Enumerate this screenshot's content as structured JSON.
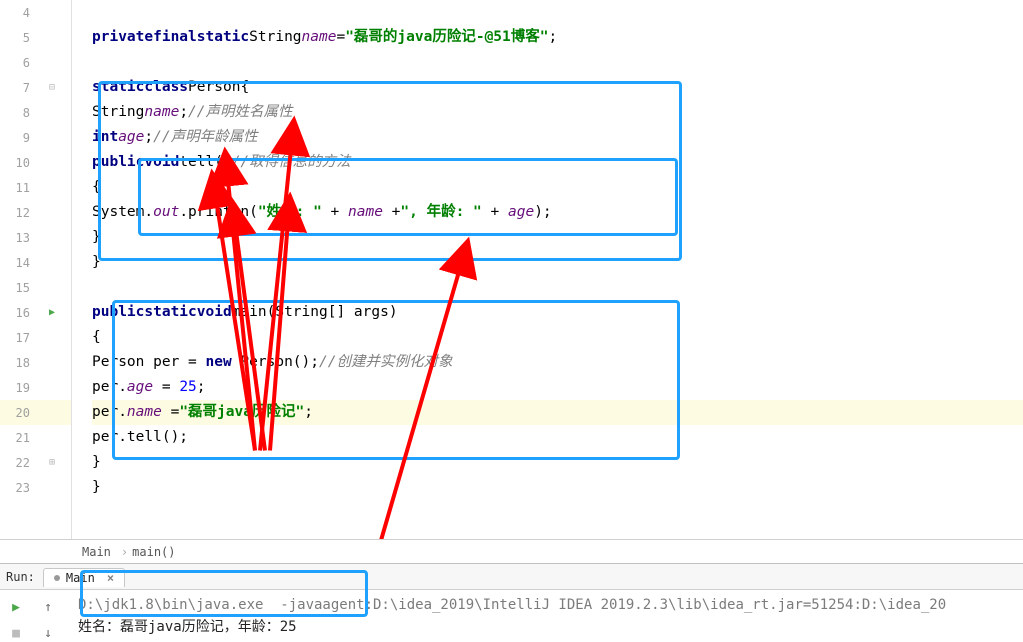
{
  "gutter": {
    "lines": [
      4,
      5,
      6,
      7,
      8,
      9,
      10,
      11,
      12,
      13,
      14,
      15,
      16,
      17,
      18,
      19,
      20,
      21,
      22,
      23
    ],
    "run_icon_line": 16
  },
  "code": {
    "l5": {
      "kws": [
        "private",
        "final",
        "static"
      ],
      "type": "String",
      "var": "name",
      "eq": "=",
      "str": "\"磊哥的java历险记-@51博客\"",
      "end": ";"
    },
    "l7": {
      "kws": [
        "static",
        "class"
      ],
      "cls": "Person",
      "open": "{"
    },
    "l8": {
      "type": "String",
      "var": "name",
      "end": ";",
      "cmt": "//声明姓名属性"
    },
    "l9": {
      "kw": "int",
      "var": "age",
      "end": ";",
      "cmt": "//声明年龄属性"
    },
    "l10": {
      "kws": [
        "public",
        "void"
      ],
      "fn": "tell()",
      "cmt": "//取得信息的方法"
    },
    "l11": {
      "open": "{"
    },
    "l12": {
      "pre": "System.",
      "out": "out",
      "mid": ".println(",
      "s1": "\"姓名: \"",
      "p1": " + ",
      "v1": "name",
      "p2": " +",
      "s2": "\", 年龄: \"",
      "p3": " + ",
      "v2": "age",
      "close": ");"
    },
    "l13": {
      "close": "}"
    },
    "l14": {
      "close": "}"
    },
    "l16": {
      "kws": [
        "public",
        "static",
        "void"
      ],
      "fn": "main(String[] args)"
    },
    "l17": {
      "open": "{"
    },
    "l18": {
      "pre": "Person per = ",
      "new": "new",
      "post": " Person();",
      "cmt": "//创建并实例化对象"
    },
    "l19": {
      "pre": "per.",
      "fld": "age",
      "post": " = ",
      "val": "25",
      "end": ";"
    },
    "l20": {
      "pre": "per.",
      "fld": "name",
      "post": " =",
      "str": "\"磊哥java历险记\"",
      "end": ";"
    },
    "l21": {
      "call": "per.tell();"
    },
    "l22": {
      "close": "}"
    },
    "l23": {
      "close": "}"
    }
  },
  "breadcrumb": {
    "a": "Main",
    "b": "main()"
  },
  "run": {
    "label": "Run:",
    "tab": "Main"
  },
  "console": {
    "cmd": "D:\\jdk1.8\\bin\\java.exe  -javaagent:D:\\idea_2019\\IntelliJ IDEA 2019.2.3\\lib\\idea_rt.jar=51254:D:\\idea_20",
    "out": "姓名：磊哥java历险记，年龄：25"
  }
}
